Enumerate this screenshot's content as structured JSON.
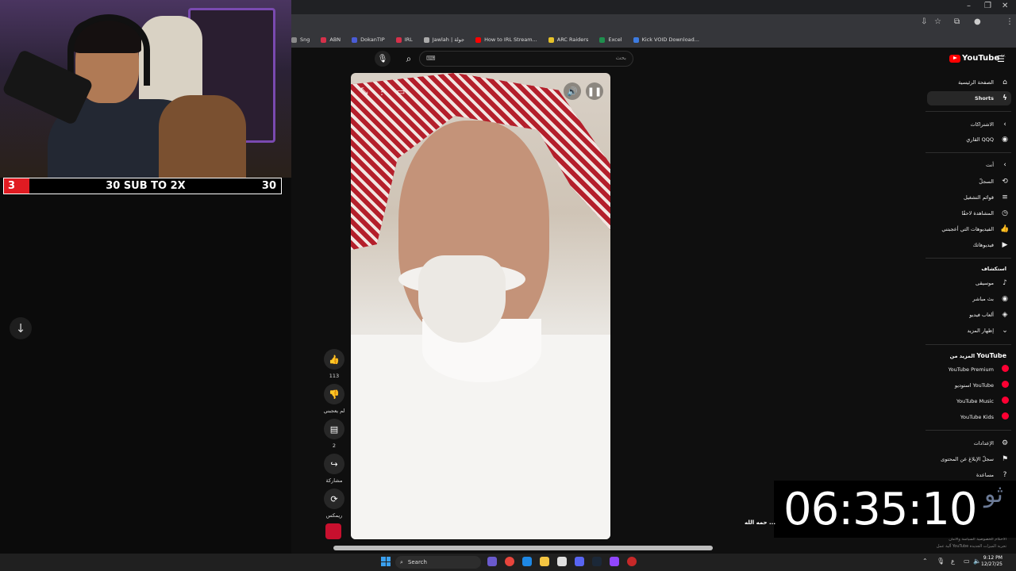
{
  "stream_overlay": {
    "sub_count": "3",
    "sub_goal_text": "30 SUB TO 2X",
    "sub_target": "30"
  },
  "bookmarks": [
    {
      "label": "Sng",
      "color": "#8a8a8a"
    },
    {
      "label": "ABN",
      "color": "#d6304a"
    },
    {
      "label": "DokanTIP",
      "color": "#4a5cd6"
    },
    {
      "label": "IRL",
      "color": "#d6304a"
    },
    {
      "label": "Jawlah | جولة",
      "color": "#aaaaaa"
    },
    {
      "label": "How to IRL Stream...",
      "color": "#ff0000"
    },
    {
      "label": "ARC Raiders",
      "color": "#e6c229"
    },
    {
      "label": "Excel",
      "color": "#1f8f4e"
    },
    {
      "label": "Kick VOID Download...",
      "color": "#3d7be0"
    }
  ],
  "search": {
    "placeholder": "بحث",
    "keyboard_icon": "⌨"
  },
  "video_actions": {
    "like_count": "113",
    "dislike_label": "لم يعجبني",
    "comment_count": "2",
    "share_label": "مشاركة",
    "remix_label": "ريمكس"
  },
  "sidebar": {
    "logo_text": "YouTube",
    "logo_country": "SA",
    "home_label": "الصفحة الرئيسية",
    "shorts_label": "Shorts",
    "subscriptions_label": "الاشتراكات",
    "subscription_channel": "القاري QQQ",
    "you_label": "أنت",
    "history_label": "السجلّ",
    "playlists_label": "قوائم التشغيل",
    "watch_later_label": "المشاهدة لاحقًا",
    "liked_label": "الفيديوهات التي أعجبتني",
    "your_videos_label": "فيديوهاتك",
    "explore_label": "استكشاف",
    "music_label": "موسيقى",
    "live_label": "بث مباشر",
    "gaming_label": "ألعاب فيديو",
    "show_more_label": "إظهار المزيد",
    "more_from_prefix": "المزيد من",
    "more_from_brand": "YouTube",
    "premium_label": "YouTube Premium",
    "studio_label": "استوديو YouTube",
    "music_app_label": "YouTube Music",
    "kids_label": "YouTube Kids",
    "settings_label": "الإعدادات",
    "report_label": "سجلّ الإبلاغ عن المحتوى",
    "help_label": "مساعدة",
    "footer_line1": "الأحكام   الخصوصية   السياسة والأمان",
    "footer_line2": "آلية عمل YouTube   تجربة الميزات الجديدة"
  },
  "timer": {
    "text": "06:35:10",
    "deco": "ثو"
  },
  "video_caption": "حمه الله ...",
  "taskbar": {
    "search_label": "Search",
    "time": "9:12 PM",
    "date": "12/27/25",
    "lang": "ع"
  },
  "colors": {
    "youtube_red": "#ff0000",
    "sub_red": "#e01b22"
  }
}
